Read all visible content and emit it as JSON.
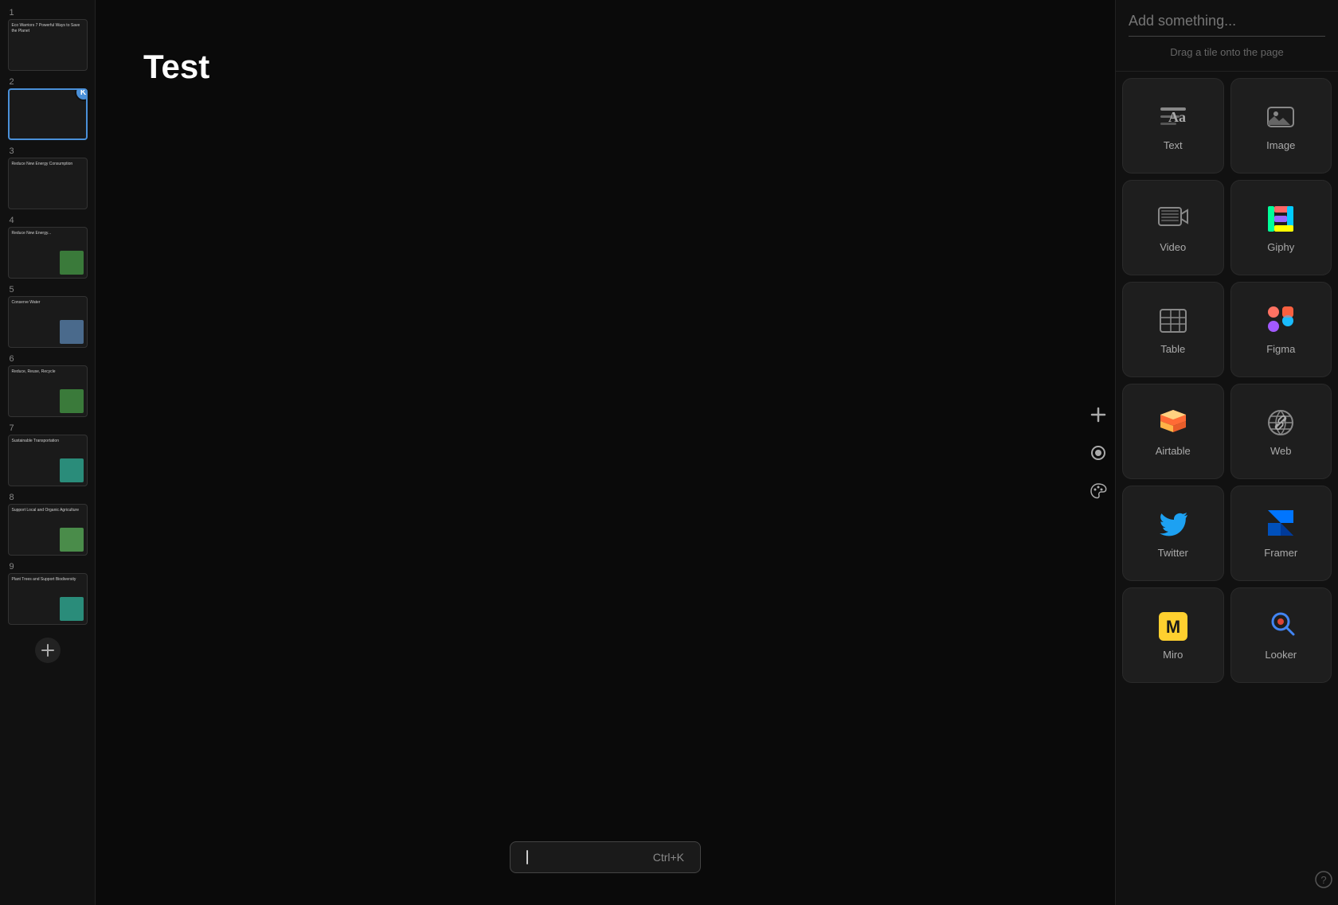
{
  "sidebar": {
    "slides": [
      {
        "number": "1",
        "title": "Eco Warriors 7 Powerful Ways to Save the Planet",
        "hasImage": false,
        "selected": false
      },
      {
        "number": "2",
        "title": "-",
        "hasAvatar": true,
        "avatarLabel": "K",
        "selected": true
      },
      {
        "number": "3",
        "title": "Reduce New Energy Consumption",
        "hasImage": false,
        "selected": false
      },
      {
        "number": "4",
        "title": "Reduce New Energy...",
        "hasImage": true,
        "imgColor": "eco-green",
        "selected": false
      },
      {
        "number": "5",
        "title": "Conserve Water",
        "hasImage": true,
        "imgColor": "blue-block",
        "selected": false
      },
      {
        "number": "6",
        "title": "Reduce, Reuse, Recycle",
        "hasImage": true,
        "imgColor": "eco-green",
        "selected": false
      },
      {
        "number": "7",
        "title": "Sustainable Transportation",
        "hasImage": true,
        "imgColor": "teal-block",
        "selected": false
      },
      {
        "number": "8",
        "title": "Support Local and Organic Agriculture",
        "hasImage": true,
        "imgColor": "green-block",
        "selected": false
      },
      {
        "number": "9",
        "title": "Plant Trees and Support Biodiversity",
        "hasImage": true,
        "imgColor": "teal-block",
        "selected": false
      }
    ],
    "add_label": "+"
  },
  "main": {
    "slide_title": "Test"
  },
  "command_bar": {
    "placeholder": "",
    "shortcut": "Ctrl+K"
  },
  "right_panel": {
    "search_placeholder": "Add something...",
    "drag_hint": "Drag a tile onto the page",
    "tiles": [
      {
        "id": "text",
        "label": "Text",
        "icon": "text"
      },
      {
        "id": "image",
        "label": "Image",
        "icon": "image"
      },
      {
        "id": "video",
        "label": "Video",
        "icon": "video"
      },
      {
        "id": "giphy",
        "label": "Giphy",
        "icon": "giphy"
      },
      {
        "id": "table",
        "label": "Table",
        "icon": "table"
      },
      {
        "id": "figma",
        "label": "Figma",
        "icon": "figma"
      },
      {
        "id": "airtable",
        "label": "Airtable",
        "icon": "airtable"
      },
      {
        "id": "web",
        "label": "Web",
        "icon": "web"
      },
      {
        "id": "twitter",
        "label": "Twitter",
        "icon": "twitter"
      },
      {
        "id": "framer",
        "label": "Framer",
        "icon": "framer"
      },
      {
        "id": "miro",
        "label": "Miro",
        "icon": "miro"
      },
      {
        "id": "looker",
        "label": "Looker",
        "icon": "looker"
      }
    ]
  },
  "toolbar": {
    "add_icon": "+",
    "record_icon": "⏺",
    "palette_icon": "🎨",
    "help_icon": "?"
  }
}
